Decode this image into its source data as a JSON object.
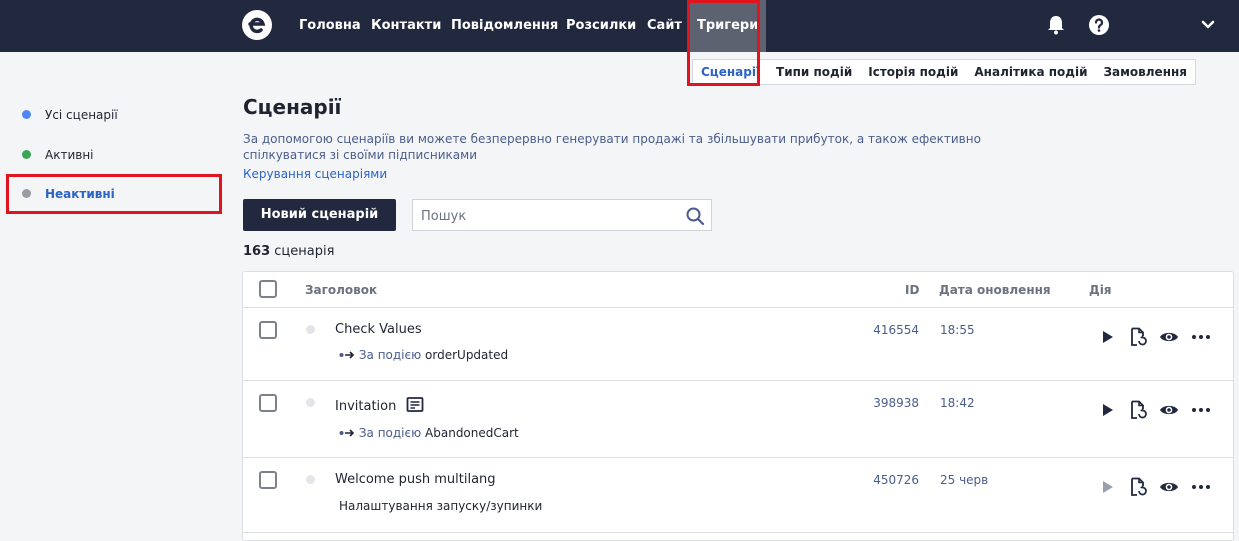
{
  "nav": {
    "items": [
      "Головна",
      "Контакти",
      "Повідомлення",
      "Розсилки",
      "Сайт"
    ],
    "active": "Тригери"
  },
  "subnav": {
    "items": [
      "Сценарії",
      "Типи подій",
      "Історія подій",
      "Аналітика подій",
      "Замовлення"
    ]
  },
  "sidebar": {
    "items": [
      {
        "label": "Усі сценарії",
        "dot_color": "#4f86f7"
      },
      {
        "label": "Активні",
        "dot_color": "#3aa655"
      },
      {
        "label": "Неактивні",
        "dot_color": "#9a9ca3"
      }
    ]
  },
  "main": {
    "title": "Сценарії",
    "description": "За допомогою сценаріїв ви можете безперервно генерувати продажі та збільшувати прибуток, а також ефективно спілкуватися зі своїми підписниками",
    "manage_link": "Керування сценаріями",
    "new_button": "Новий сценарій",
    "search_placeholder": "Пошук",
    "count_number": "163",
    "count_label": "сценарія"
  },
  "table": {
    "headers": {
      "title": "Заголовок",
      "id": "ID",
      "date": "Дата оновлення",
      "action": "Дія"
    },
    "rows": [
      {
        "title": "Check Values",
        "sub_label": "За подією",
        "sub_value": "orderUpdated",
        "id": "416554",
        "date": "18:55"
      },
      {
        "title": "Invitation",
        "sub_label": "За подією",
        "sub_value": "AbandonedCart",
        "id": "398938",
        "date": "18:42"
      },
      {
        "title": "Welcome push multilang",
        "sub_label": "",
        "sub_value": "Налаштування запуску/зупинки",
        "id": "450726",
        "date": "25 черв"
      }
    ]
  },
  "colors": {
    "topbar": "#22293f",
    "accent": "#2b63c6",
    "highlight": "#e0141e"
  }
}
